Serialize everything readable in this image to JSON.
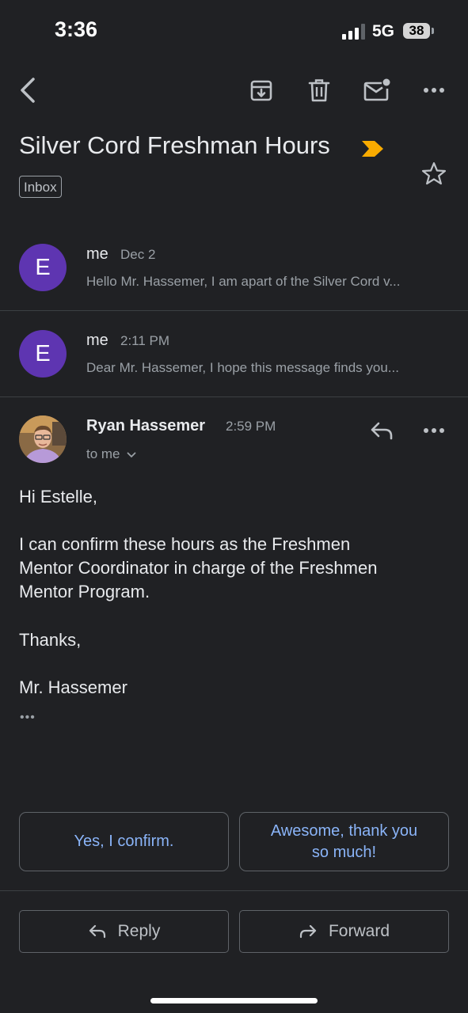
{
  "status_bar": {
    "time": "3:36",
    "network": "5G",
    "battery": "38"
  },
  "email": {
    "subject": "Silver Cord Freshman Hours",
    "label": "Inbox",
    "colors": {
      "important_marker": "#f9ab00",
      "avatar_bg": "#5e35b1",
      "accent": "#8ab4f8"
    }
  },
  "thread": [
    {
      "avatar_letter": "E",
      "sender": "me",
      "date": "Dec 2",
      "snippet": "Hello Mr. Hassemer, I am apart of the Silver Cord v..."
    },
    {
      "avatar_letter": "E",
      "sender": "me",
      "date": "2:11 PM",
      "snippet": "Dear Mr. Hassemer, I hope this message finds you..."
    }
  ],
  "open_message": {
    "sender": "Ryan Hassemer",
    "time": "2:59 PM",
    "recipient": "to me",
    "greeting": "Hi Estelle,",
    "paragraph_lines": [
      "I can confirm these hours as the Freshmen",
      "Mentor Coordinator in charge of the Freshmen",
      "Mentor Program."
    ],
    "closing": "Thanks,",
    "signature": "Mr. Hassemer",
    "trimmed_marker": "•••"
  },
  "smart_replies": [
    {
      "lines": [
        "Yes, I confirm."
      ]
    },
    {
      "lines": [
        "Awesome, thank you",
        "so much!"
      ]
    }
  ],
  "actions": {
    "reply": "Reply",
    "forward": "Forward"
  }
}
